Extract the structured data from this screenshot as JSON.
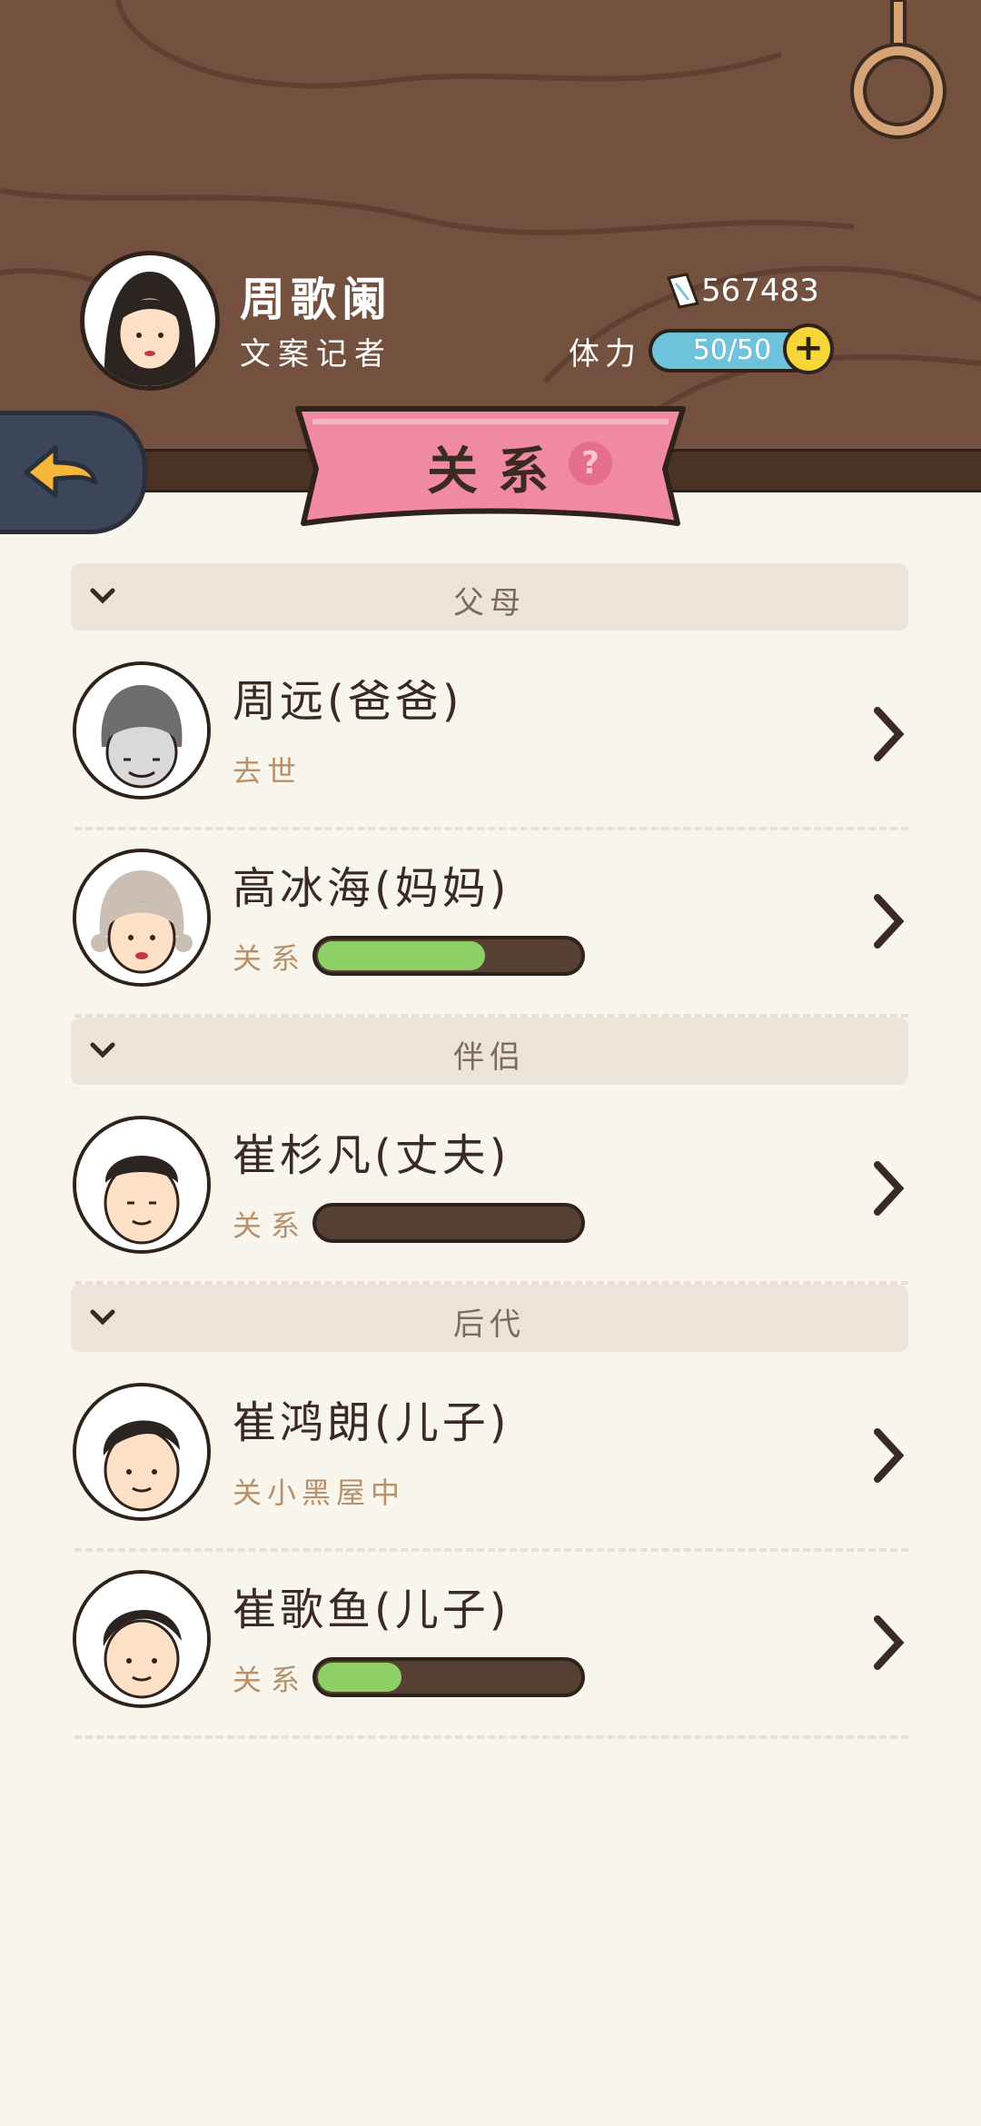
{
  "player": {
    "name": "周歌阑",
    "job": "文案记者",
    "money": "567483",
    "stamina_label": "体力",
    "stamina_value": "50/50"
  },
  "page": {
    "title": "关系",
    "help": "?"
  },
  "sections": [
    {
      "title": "父母",
      "items": [
        {
          "name": "周远(爸爸)",
          "status": "去世"
        },
        {
          "name": "高冰海(妈妈)",
          "rel_label": "关系",
          "relationship": 0.64
        }
      ]
    },
    {
      "title": "伴侣",
      "items": [
        {
          "name": "崔杉凡(丈夫)",
          "rel_label": "关系",
          "relationship": 0.0
        }
      ]
    },
    {
      "title": "后代",
      "items": [
        {
          "name": "崔鸿朗(儿子)",
          "status": "关小黑屋中"
        },
        {
          "name": "崔歌鱼(儿子)",
          "rel_label": "关系",
          "relationship": 0.32
        }
      ]
    }
  ],
  "colors": {
    "header_bg": "#74513f",
    "page_bg": "#f8f5ec",
    "ribbon": "#f08aa0",
    "bar_fill": "#8fd066",
    "stamina": "#6dc3dc"
  },
  "icons": [
    "back-arrow-icon",
    "money-note-icon",
    "plus-icon",
    "help-icon",
    "chevron-down-icon",
    "chevron-right-icon"
  ]
}
